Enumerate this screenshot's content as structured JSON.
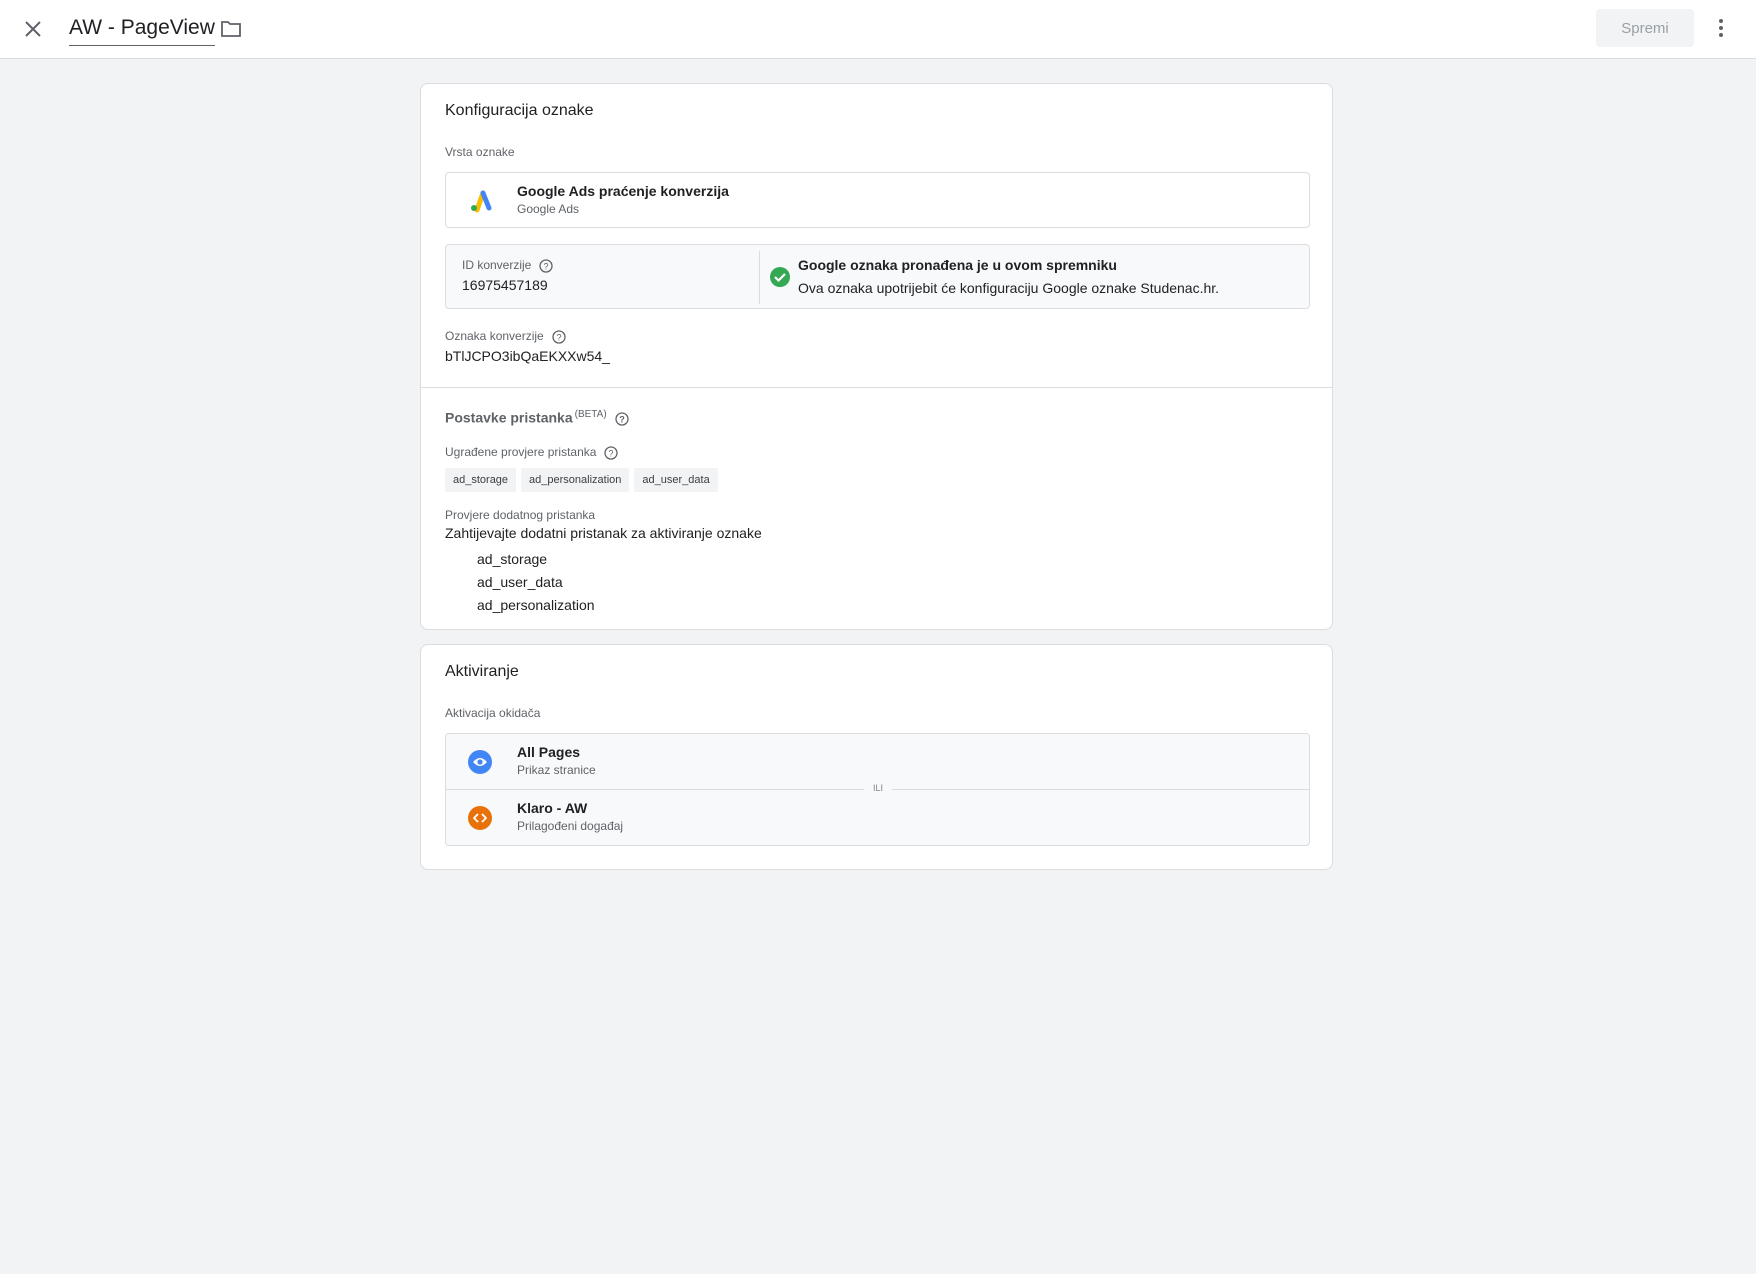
{
  "header": {
    "tag_name": "AW - PageView",
    "save_label": "Spremi"
  },
  "config": {
    "title": "Konfiguracija oznake",
    "type_label": "Vrsta oznake",
    "type_name": "Google Ads praćenje konverzija",
    "type_sub": "Google Ads",
    "conversion_id_label": "ID konverzije",
    "conversion_id": "16975457189",
    "gtag_title": "Google oznaka pronađena je u ovom spremniku",
    "gtag_sub": "Ova oznaka upotrijebit će konfiguraciju Google oznake Studenac.hr.",
    "conversion_label_label": "Oznaka konverzije",
    "conversion_label": "bTlJCPO3ibQaEKXXw54_"
  },
  "consent": {
    "title": "Postavke pristanka",
    "beta": "(BETA)",
    "builtin_label": "Ugrađene provjere pristanka",
    "builtin_chips": [
      "ad_storage",
      "ad_personalization",
      "ad_user_data"
    ],
    "extra_label": "Provjere dodatnog pristanka",
    "extra_text": "Zahtijevajte dodatni pristanak za aktiviranje oznake",
    "extra_items": [
      "ad_storage",
      "ad_user_data",
      "ad_personalization"
    ]
  },
  "triggering": {
    "title": "Aktiviranje",
    "label": "Aktivacija okidača",
    "or_label": "ILI",
    "triggers": [
      {
        "name": "All Pages",
        "sub": "Prikaz stranice",
        "icon": "eye-icon",
        "color": "#4285f4"
      },
      {
        "name": "Klaro - AW",
        "sub": "Prilagođeni događaj",
        "icon": "code-icon",
        "color": "#e8710a"
      }
    ]
  },
  "colors": {
    "background": "#f1f3f4",
    "success": "#34a853",
    "ads_blue": "#4285f4",
    "ads_yellow": "#fbbc04",
    "ads_green": "#34a853"
  }
}
